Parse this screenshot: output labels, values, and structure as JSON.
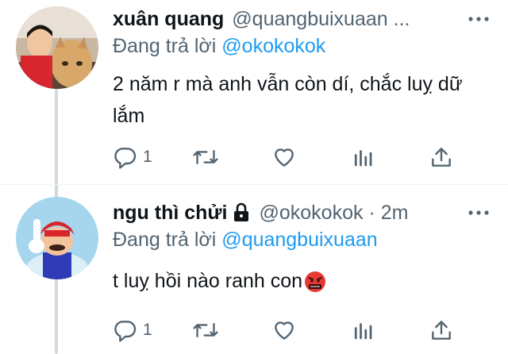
{
  "tweets": [
    {
      "name": "xuân quang",
      "handle": "@quangbuixuaan ...",
      "reply_prefix": "Đang trả lời ",
      "reply_mention": "@okokokok",
      "text": "2 năm r mà anh vẫn còn dí, chắc luỵ dữ lắm",
      "reply_count": "1"
    },
    {
      "name": "ngu thì chửi",
      "handle": "@okokokok · 2m",
      "reply_prefix": "Đang trả lời ",
      "reply_mention": "@quangbuixuaan",
      "text": "t luỵ hồi nào ranh con",
      "reply_count": "1"
    }
  ],
  "icons": {
    "more": "more-dots-icon",
    "reply": "reply-bubble-icon",
    "retweet": "retweet-arrows-icon",
    "like": "heart-icon",
    "analytics": "analytics-bars-icon",
    "share": "share-upload-icon",
    "lock": "lock-icon",
    "emoji": "angry-cursing-face-emoji"
  },
  "colors": {
    "text": "#0f1419",
    "secondary": "#536471",
    "link": "#1d9bf0",
    "thread_line": "#cfd9de"
  }
}
